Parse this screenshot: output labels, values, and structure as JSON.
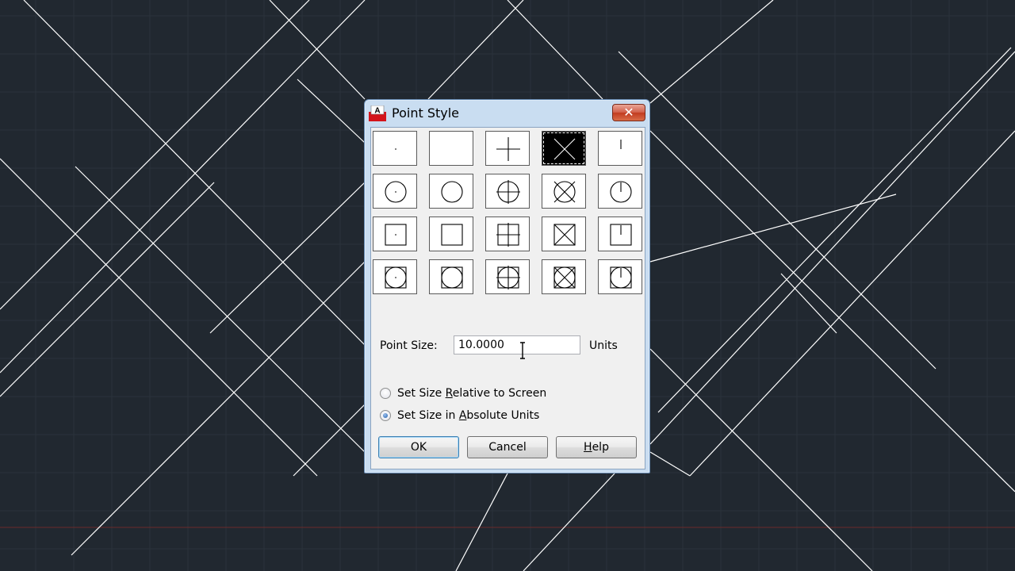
{
  "dialog": {
    "title": "Point Style",
    "close_glyph": "✕",
    "app_icon": "autocad-icon"
  },
  "point_styles": [
    [
      "dot",
      "none",
      "plus",
      "x",
      "tick"
    ],
    [
      "circle-dot",
      "circle",
      "circle-plus",
      "circle-x",
      "circle-tick"
    ],
    [
      "square-dot",
      "square",
      "square-plus",
      "square-x",
      "square-tick"
    ],
    [
      "circle-square-dot",
      "circle-square",
      "circle-square-plus",
      "circle-square-x",
      "circle-square-tick"
    ]
  ],
  "selected_style": "x",
  "point_size": {
    "label": "Point Size:",
    "value": "10.0000",
    "units_label": "Units"
  },
  "size_mode": {
    "relative_prefix": "Set Size ",
    "relative_hotkey": "R",
    "relative_suffix": "elative to Screen",
    "absolute_prefix": "Set Size in ",
    "absolute_hotkey": "A",
    "absolute_suffix": "bsolute Units",
    "selected": "absolute"
  },
  "buttons": {
    "ok": "OK",
    "cancel": "Cancel",
    "help_hotkey": "H",
    "help_rest": "elp"
  },
  "colors": {
    "background": "#212830",
    "grid_line": "#2a323b",
    "geometry_line": "#ffffff",
    "axis_line": "#6a2a2a"
  }
}
